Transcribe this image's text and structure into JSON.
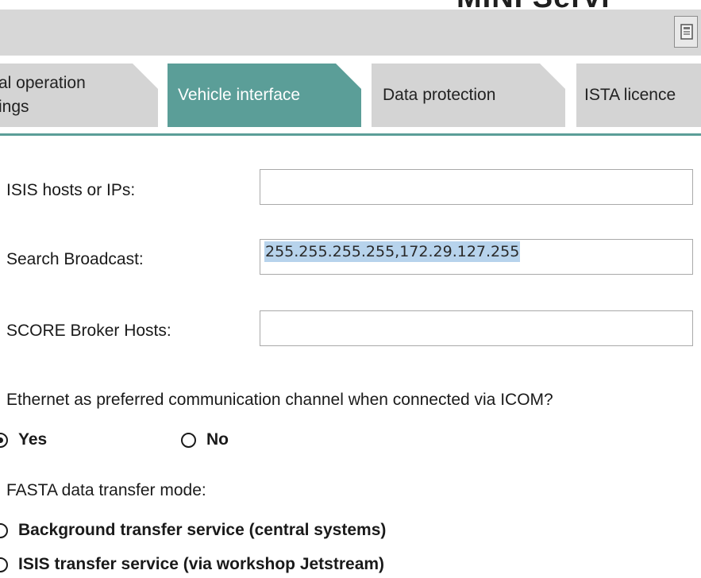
{
  "app": {
    "title_partial": "MINI Servi"
  },
  "toolbar": {
    "print_icon": "print-icon"
  },
  "tabs": [
    {
      "label_line1": "al operation",
      "label_line2": "ings",
      "active": false
    },
    {
      "label": "Vehicle interface",
      "active": true
    },
    {
      "label": "Data protection",
      "active": false
    },
    {
      "label": "ISTA licence",
      "active": false
    }
  ],
  "form": {
    "isis_hosts": {
      "label": "ISIS hosts or IPs:",
      "value": ""
    },
    "search_broadcast": {
      "label": "Search Broadcast:",
      "value": "255.255.255.255,172.29.127.255"
    },
    "score_broker": {
      "label": "SCORE Broker Hosts:",
      "value": ""
    },
    "ethernet_question": "Ethernet as preferred communication channel when connected via ICOM?",
    "ethernet_options": [
      {
        "label": "Yes",
        "selected": true
      },
      {
        "label": "No",
        "selected": false
      }
    ],
    "fasta_label": "FASTA data transfer mode:",
    "fasta_options": [
      {
        "label": "Background transfer service (central systems)",
        "selected": false
      },
      {
        "label": "ISIS transfer service (via workshop Jetstream)",
        "selected": false
      }
    ]
  },
  "colors": {
    "active_tab": "#5b9e98",
    "inactive_tab": "#d4d4d4",
    "title_bar": "#d7d7d7",
    "selection": "#b7d3ec"
  }
}
